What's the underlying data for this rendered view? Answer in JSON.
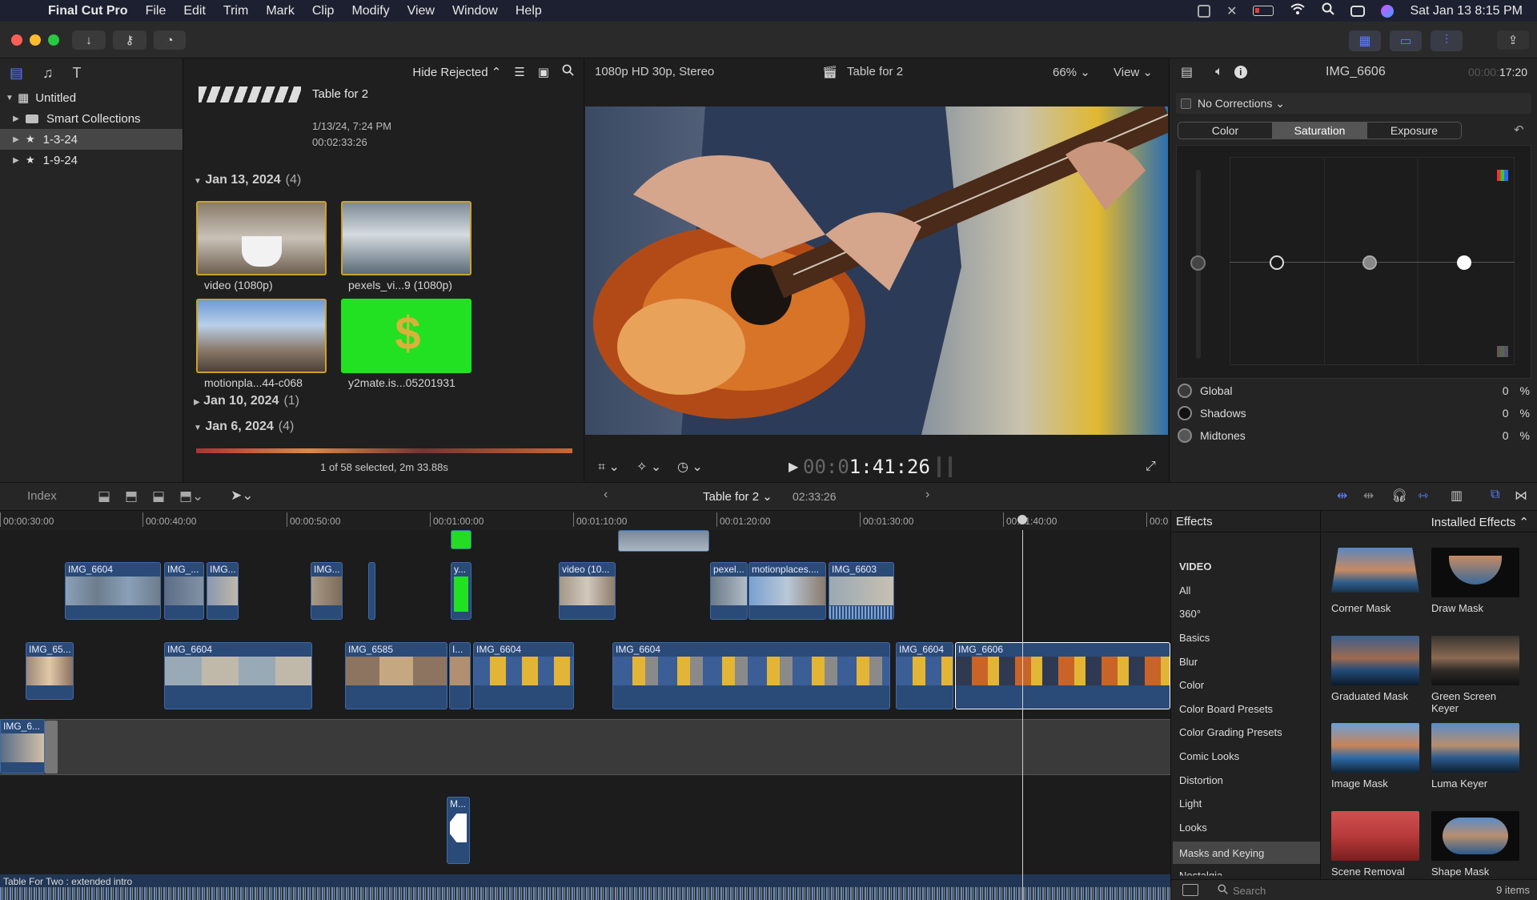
{
  "menubar": {
    "app_name": "Final Cut Pro",
    "items": [
      "File",
      "Edit",
      "Trim",
      "Mark",
      "Clip",
      "Modify",
      "View",
      "Window",
      "Help"
    ],
    "datetime": "Sat Jan 13  8:15 PM"
  },
  "sidebar": {
    "library": "Untitled",
    "items": [
      "Smart Collections",
      "1-3-24",
      "1-9-24"
    ]
  },
  "browser": {
    "filter": "Hide Rejected",
    "project": {
      "title": "Table for 2",
      "date": "1/13/24, 7:24 PM",
      "duration": "00:02:33:26"
    },
    "groups": [
      {
        "date": "Jan 13, 2024",
        "count": "(4)"
      },
      {
        "date": "Jan 10, 2024",
        "count": "(1)"
      },
      {
        "date": "Jan 6, 2024",
        "count": "(4)"
      }
    ],
    "clips": [
      "video (1080p)",
      "pexels_vi...9 (1080p)",
      "motionpla...44-c068",
      "y2mate.is...05201931"
    ],
    "status": "1 of 58 selected, 2m 33.88s"
  },
  "viewer": {
    "format": "1080p HD 30p, Stereo",
    "title": "Table for 2",
    "zoom": "66%",
    "view_label": "View",
    "timecode_dim": "00:0",
    "timecode": "1:41:26"
  },
  "inspector": {
    "clip_name": "IMG_6606",
    "time_dim": "00:00:",
    "time": "17:20",
    "corrections": "No Corrections",
    "tabs": [
      "Color",
      "Saturation",
      "Exposure"
    ],
    "params": [
      {
        "name": "Global",
        "value": "0",
        "unit": "%"
      },
      {
        "name": "Shadows",
        "value": "0",
        "unit": "%"
      },
      {
        "name": "Midtones",
        "value": "0",
        "unit": "%"
      }
    ]
  },
  "timeline": {
    "index_label": "Index",
    "project": "Table for 2",
    "duration": "02:33:26",
    "ruler": [
      "00:00:30:00",
      "00:00:40:00",
      "00:00:50:00",
      "00:01:00:00",
      "00:01:10:00",
      "00:01:20:00",
      "00:01:30:00",
      "00:01:40:00",
      "00:0"
    ],
    "connected_clips": [
      "IMG_6604",
      "IMG_...",
      "IMG...",
      "IMG...",
      "y...",
      "video (10...",
      "pexel...",
      "motionplaces....",
      "IMG_6603"
    ],
    "primary_clips": [
      "IMG_65...",
      "IMG_6604",
      "IMG_6585",
      "I...",
      "IMG_6604",
      "IMG_6604",
      "IMG_6604",
      "IMG_6606"
    ],
    "gap_clip": "IMG_6...",
    "audio_clip": "M...",
    "bottom_label": "Table For Two : extended intro"
  },
  "effects": {
    "title": "Effects",
    "source": "Installed Effects",
    "section": "VIDEO",
    "categories": [
      "All",
      "360°",
      "Basics",
      "Blur",
      "Color",
      "Color Board Presets",
      "Color Grading Presets",
      "Comic Looks",
      "Distortion",
      "Light",
      "Looks",
      "Masks and Keying",
      "Nostalgia"
    ],
    "tiles": [
      "Corner Mask",
      "Draw Mask",
      "Graduated Mask",
      "Green Screen Keyer",
      "Image Mask",
      "Luma Keyer",
      "Scene Removal",
      "Shape Mask"
    ],
    "count": "9 items",
    "search_placeholder": "Search"
  },
  "colors": {
    "accent": "#5b7cff",
    "clip_blue": "#2a4a78",
    "selection_gold": "#c9a227"
  }
}
